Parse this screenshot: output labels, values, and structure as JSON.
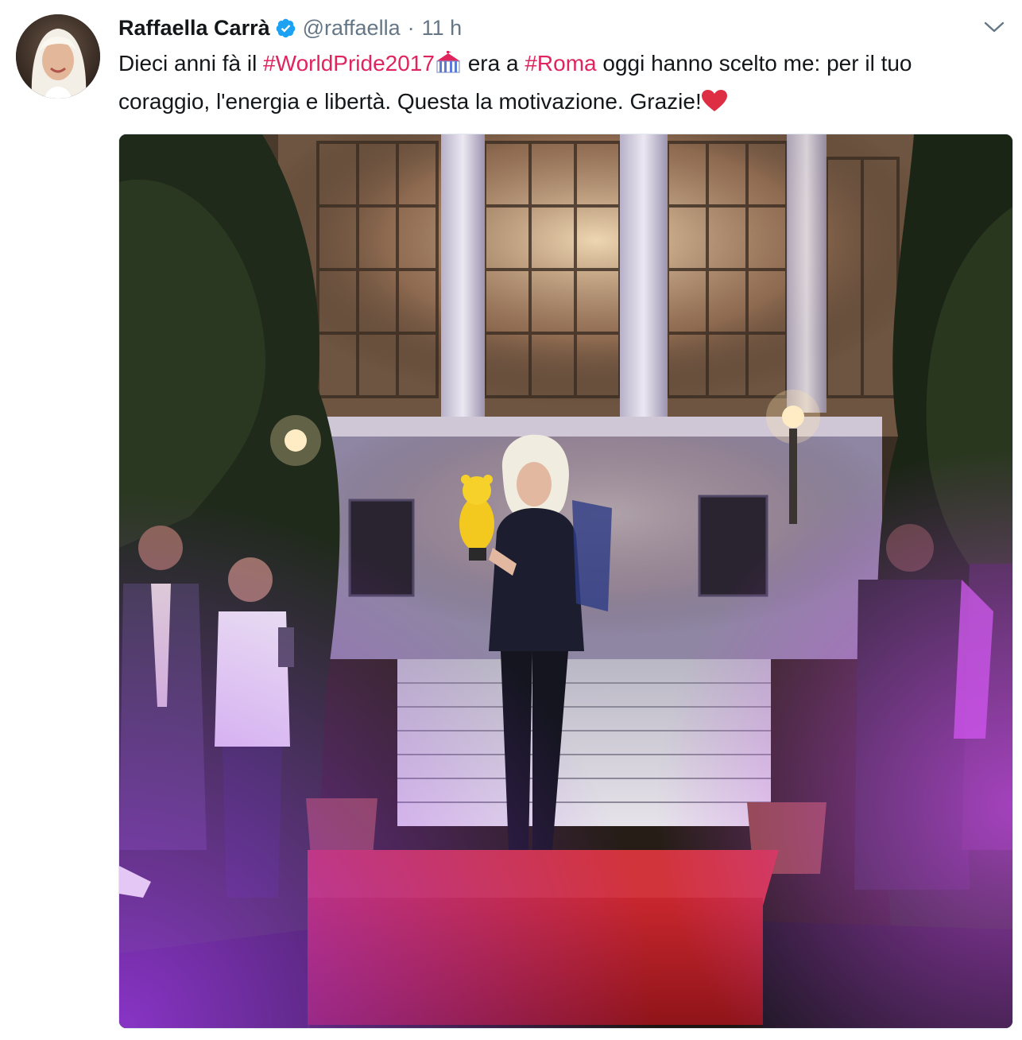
{
  "tweet": {
    "author": {
      "display_name": "Raffaella Carrà",
      "screen_name": "@raffaella",
      "verified_icon": "verified-badge-icon",
      "avatar_icon": "avatar"
    },
    "separator": "·",
    "timestamp": "11 h",
    "menu_icon": "chevron-down-icon",
    "text": {
      "part1": "Dieci anni fà il ",
      "hashtag1": "#WorldPride2017",
      "emoji1": "circus-tent-emoji",
      "part2": " era a ",
      "hashtag2": "#Roma",
      "part3": " oggi hanno scelto me: per il tuo coraggio, l'energia e libertà. Questa la motivazione. Grazie!",
      "emoji2": "red-heart-emoji"
    },
    "media": {
      "type": "photo",
      "icon": "event-photo"
    }
  },
  "colors": {
    "text": "#14171a",
    "secondary": "#657786",
    "hashtag": "#e0245e",
    "verified": "#1da1f2",
    "heart": "#e0245e",
    "border": "#e1e8ed"
  }
}
